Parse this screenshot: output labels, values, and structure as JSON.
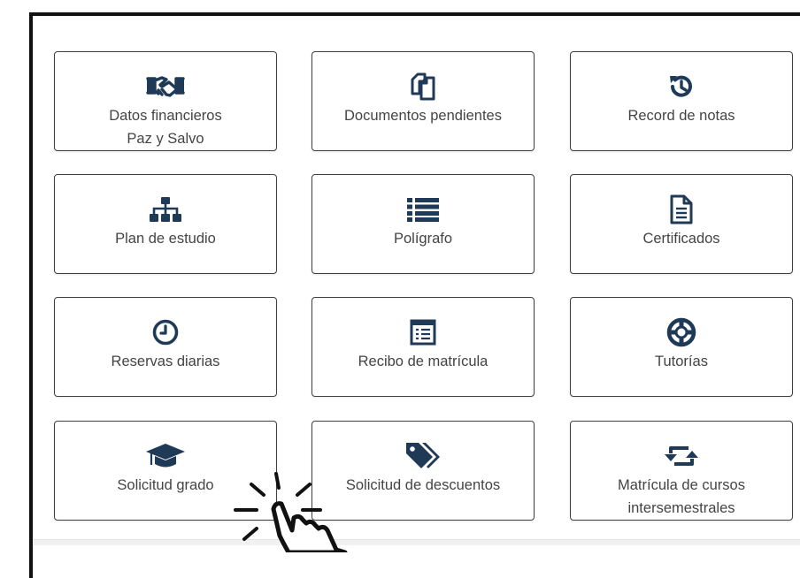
{
  "tiles": [
    {
      "label_line1": "Datos financieros",
      "label_line2": "Paz y Salvo",
      "icon": "handshake-icon"
    },
    {
      "label_line1": "Documentos pendientes",
      "icon": "copy-icon"
    },
    {
      "label_line1": "Record de notas",
      "icon": "history-icon"
    },
    {
      "label_line1": "Plan de estudio",
      "icon": "sitemap-icon"
    },
    {
      "label_line1": "Polígrafo",
      "icon": "list-icon"
    },
    {
      "label_line1": "Certificados",
      "icon": "file-text-icon"
    },
    {
      "label_line1": "Reservas diarias",
      "icon": "clock-icon"
    },
    {
      "label_line1": "Recibo de matrícula",
      "icon": "receipt-icon"
    },
    {
      "label_line1": "Tutorías",
      "icon": "life-ring-icon"
    },
    {
      "label_line1": "Solicitud grado",
      "icon": "graduation-cap-icon"
    },
    {
      "label_line1": "Solicitud de descuentos",
      "icon": "tags-icon"
    },
    {
      "label_line1": "Matrícula de cursos",
      "label_line2": "intersemestrales",
      "icon": "retweet-icon"
    }
  ],
  "colors": {
    "icon": "#1f3a57",
    "text": "#444444",
    "border": "#3f3f3f"
  }
}
